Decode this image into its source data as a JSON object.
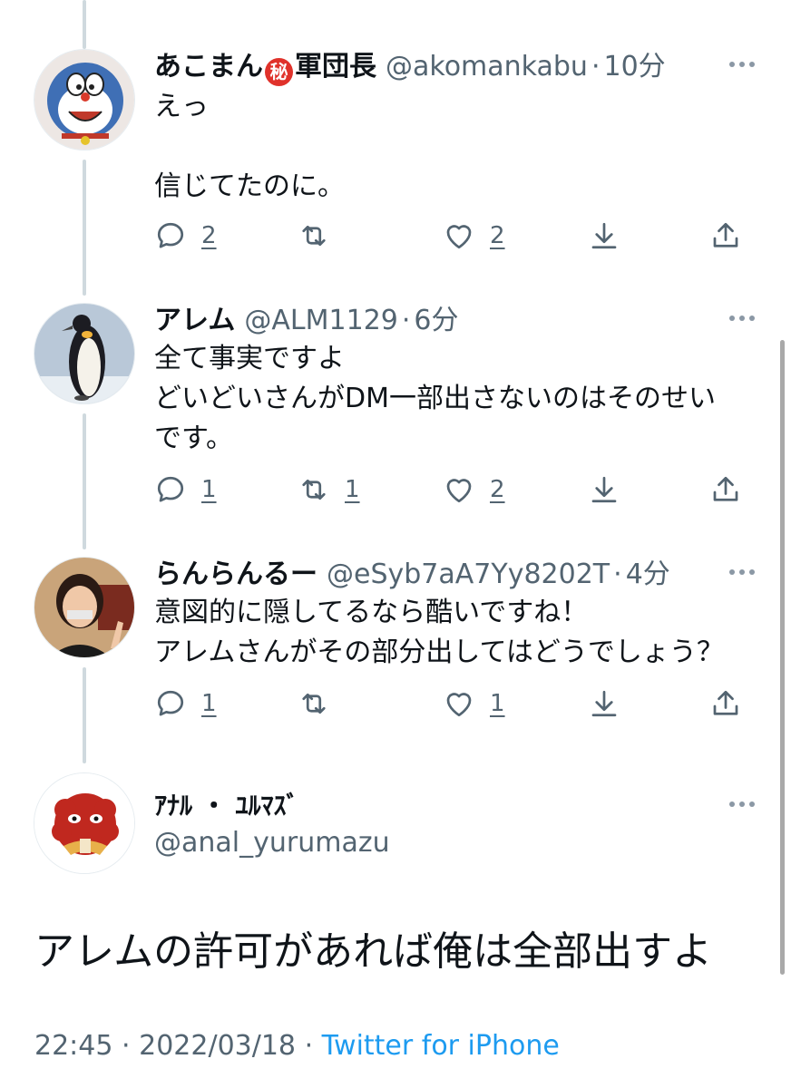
{
  "thread": [
    {
      "display_name": "あこまん",
      "badge": "秘",
      "name_suffix": "軍団長",
      "handle": "@akomankabu",
      "separator": "·",
      "time": "10分",
      "lines": [
        "えっ",
        "",
        "信じてたのに。"
      ],
      "replies": "2",
      "retweets": "",
      "likes": "2",
      "avatar": "cartoon-cat-avatar"
    },
    {
      "display_name": "アレム",
      "handle": "@ALM1129",
      "separator": "·",
      "time": "6分",
      "lines": [
        "全て事実ですよ",
        "どいどいさんがDM一部出さないのはそのせい",
        "です。"
      ],
      "replies": "1",
      "retweets": "1",
      "likes": "2",
      "avatar": "penguin-avatar"
    },
    {
      "display_name": "らんらんるー",
      "handle": "@eSyb7aA7Yy8202T",
      "separator": "·",
      "time": "4分",
      "lines": [
        "意図的に隠してるなら酷いですね！",
        "アレムさんがその部分出してはどうでしょう？"
      ],
      "replies": "1",
      "retweets": "",
      "likes": "1",
      "avatar": "person-avatar"
    }
  ],
  "main_tweet": {
    "display_name": "ｱﾅﾙ ・ ﾕﾙﾏｽﾞ",
    "handle": "@anal_yurumazu",
    "text": "アレムの許可があれば俺は全部出すよ",
    "time": "22:45",
    "separator": "·",
    "date": "2022/03/18",
    "source": "Twitter for iPhone",
    "avatar": "red-mask-avatar"
  },
  "colors": {
    "text": "#0f1419",
    "secondary": "#536471",
    "link": "#1d9bf0",
    "thread_line": "#cfd9de",
    "badge": "#e0322b"
  },
  "icons": [
    "reply-icon",
    "retweet-icon",
    "like-icon",
    "download-icon",
    "share-icon",
    "more-icon"
  ]
}
